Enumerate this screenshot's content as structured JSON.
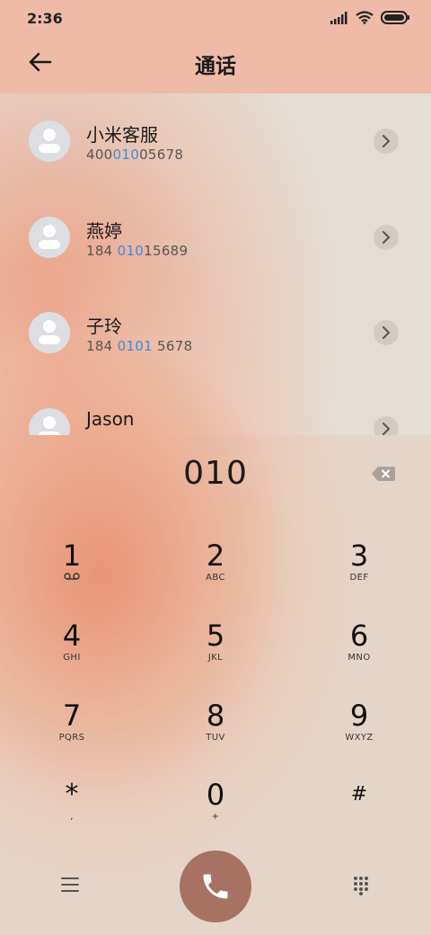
{
  "status": {
    "time": "2:36"
  },
  "header": {
    "title": "通话",
    "back_icon": "arrow-left-icon"
  },
  "contacts": [
    {
      "name": "小米客服",
      "number_pre": "400",
      "number_hl": "010",
      "number_post": "05678"
    },
    {
      "name": "燕婷",
      "number_pre": "184 ",
      "number_hl": "010",
      "number_post": "15689"
    },
    {
      "name": "子玲",
      "number_pre": "184 ",
      "number_hl": "0101",
      "number_post": " 5678"
    },
    {
      "name": "Jason",
      "number_pre": "",
      "number_hl": "",
      "number_post": ""
    }
  ],
  "dialer": {
    "input": "010",
    "keys": [
      {
        "digit": "1",
        "sub": ""
      },
      {
        "digit": "2",
        "sub": "ABC"
      },
      {
        "digit": "3",
        "sub": "DEF"
      },
      {
        "digit": "4",
        "sub": "GHI"
      },
      {
        "digit": "5",
        "sub": "JKL"
      },
      {
        "digit": "6",
        "sub": "MNO"
      },
      {
        "digit": "7",
        "sub": "PQRS"
      },
      {
        "digit": "8",
        "sub": "TUV"
      },
      {
        "digit": "9",
        "sub": "WXYZ"
      },
      {
        "digit": "*",
        "sub": ","
      },
      {
        "digit": "0",
        "sub": "+"
      },
      {
        "digit": "#",
        "sub": ""
      }
    ]
  },
  "colors": {
    "accent_highlight": "#3b8ed8",
    "call_button": "#a87262",
    "header_bg": "#efbba7"
  }
}
